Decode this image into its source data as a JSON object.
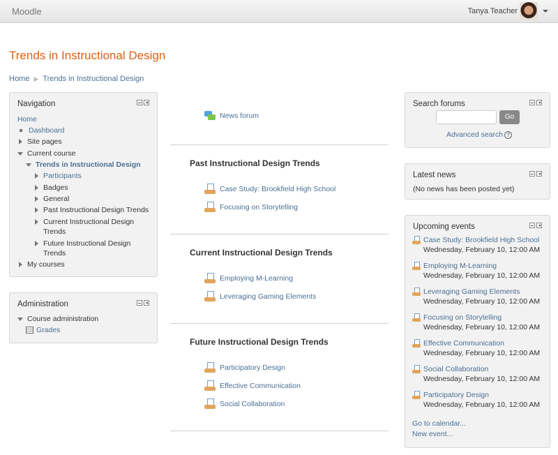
{
  "navbar": {
    "brand": "Moodle",
    "user_name": "Tanya Teacher"
  },
  "page_title": "Trends in Instructional Design",
  "breadcrumb": {
    "home": "Home",
    "sep": "▶",
    "course": "Trends in Instructional Design"
  },
  "navigation": {
    "title": "Navigation",
    "home": "Home",
    "dashboard": "Dashboard",
    "site_pages": "Site pages",
    "current_course": "Current course",
    "course": "Trends in Instructional Design",
    "participants": "Participants",
    "badges": "Badges",
    "general": "General",
    "past": "Past Instructional Design Trends",
    "current_l1": "Current Instructional Design",
    "current_l2": "Trends",
    "future_l1": "Future Instructional Design",
    "future_l2": "Trends",
    "my_courses": "My courses"
  },
  "administration": {
    "title": "Administration",
    "course_admin": "Course administration",
    "grades": "Grades"
  },
  "main": {
    "news_forum": "News forum",
    "sections": [
      {
        "title": "Past Instructional Design Trends",
        "activities": [
          "Case Study: Brookfield High School",
          "Focusing on Storytelling"
        ]
      },
      {
        "title": "Current Instructional Design Trends",
        "activities": [
          "Employing M-Learning",
          "Leveraging Gaming Elements"
        ]
      },
      {
        "title": "Future Instructional Design Trends",
        "activities": [
          "Participatory Design",
          "Effective Communication",
          "Social Collaboration"
        ]
      }
    ]
  },
  "search_forums": {
    "title": "Search forums",
    "input_value": "",
    "go_label": "Go",
    "advanced": "Advanced search",
    "help_glyph": "?"
  },
  "latest_news": {
    "title": "Latest news",
    "empty": "(No news has been posted yet)"
  },
  "upcoming": {
    "title": "Upcoming events",
    "events": [
      {
        "name": "Case Study: Brookfield High School",
        "date": "Wednesday, February 10, 12:00 AM"
      },
      {
        "name": "Employing M-Learning",
        "date": "Wednesday, February 10, 12:00 AM"
      },
      {
        "name": "Leveraging Gaming Elements",
        "date": "Wednesday, February 10, 12:00 AM"
      },
      {
        "name": "Focusing on Storytelling",
        "date": "Wednesday, February 10, 12:00 AM"
      },
      {
        "name": "Effective Communication",
        "date": "Wednesday, February 10, 12:00 AM"
      },
      {
        "name": "Social Collaboration",
        "date": "Wednesday, February 10, 12:00 AM"
      },
      {
        "name": "Participatory Design",
        "date": "Wednesday, February 10, 12:00 AM"
      }
    ],
    "goto_calendar": "Go to calendar...",
    "new_event": "New event..."
  }
}
